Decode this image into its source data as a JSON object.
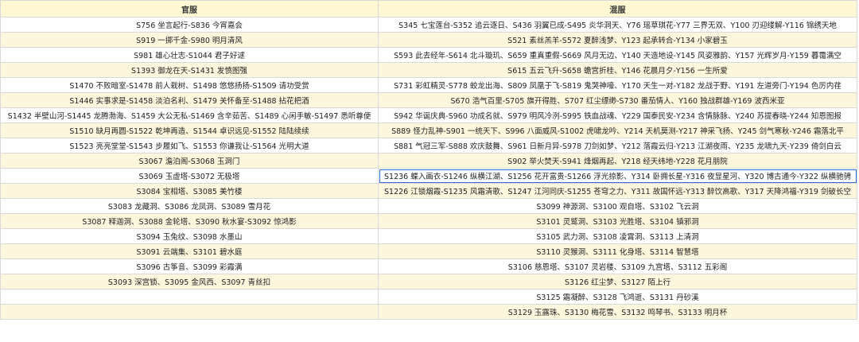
{
  "headers": [
    "官服",
    "混服"
  ],
  "rows": [
    [
      "S756 坐言起行-S836 今宵嘉会",
      "S345 七宝莲台-S352 追云逐日、S436 羽翼已成-S495 炎华洞天、Y76 瑶草琪花-Y77 三界无双、Y100 刃迎缕解-Y116 锦绣天地"
    ],
    [
      "S919 一掷千金-S980 明月清风",
      "S521 素丝羔羊-S572 夏醉浅梦、Y123 起承转合-Y134 小家碧玉"
    ],
    [
      "S981 雄心壮志-S1044 君子好逑",
      "S593 此去经年-S614 北斗璇玑、S659 重真重假-S669 风月无边、Y140 天造地设-Y145 风姿雅韵、Y157 光辉岁月-Y159 暮霭满空"
    ],
    [
      "S1393 御龙在天-S1431 发愤图强",
      "S615 五云飞升-S658 蟾宫折桂、Y146 花晨月夕-Y156 一生所爱"
    ],
    [
      "S1470 不败暗室-S1478 前人栽树、S1498 悠悠扬扬-S1509 请功受赏",
      "S731 彩虹精灵-S778 蛟龙出海、S809 凤凰于飞-S819 鬼哭神嚎、Y170 天生一对-Y182 龙战于野、Y191 左道旁门-Y194 色厉内荏"
    ],
    [
      "S1446 实事求是-S1458 淡泊名利、S1479 关怀备至-S1488 拈花把酒",
      "S670 浩气百里-S705 旗开得胜、S707 红尘缥缈-S730 番茄情人、Y160 独战群雄-Y169 波西米亚"
    ],
    [
      "S1432 半壁山河-S1445 龙腾渤海、S1459 大公无私-S1469 含辛茹苦、S1489 心闲手敏-S1497 悉听尊便",
      "S942 华诞庆典-S960 功成名就、S979 明风冷洌-S995 铁血战魂、Y229 国泰民安-Y234 含情脉脉、Y240 苏提春晓-Y244 知恩图报"
    ],
    [
      "S1510 缺月再圆-S1522 乾坤再造、S1544 卓识远见-S1552 陆陆续续",
      "S889 怪力乱神-S901 一统天下、S996 八面威风-S1002 虎啸龙吟、Y214 天机莫测-Y217 神采飞扬、Y245 剑气寒秋-Y246 霜落北平"
    ],
    [
      "S1523 亮亮堂堂-S1543 步履如飞、S1553 你谦我让-S1564 光明大道",
      "S881 气冠三军-S888 欢庆鼓舞、S961 日新月异-S978 刀剑如梦、Y212 落霞云归-Y213 江湖夜雨、Y235 龙啸九天-Y239 倚剑白云"
    ],
    [
      "S3067 澹泊阁-S3068 玉洞门",
      "S902 举火焚天-S941 烽烟再起、Y218 经天纬地-Y228 花月朋院"
    ],
    [
      "S3069 玉虚塔-S3072 无极塔",
      "S1236 蝶入画衣-S1246 纵横江湖、S1256 花开富贵-S1266 浮光掠影、Y314 卧拥长星-Y316 夜显星河、Y320 博古通今-Y322 纵横驰骋"
    ],
    [
      "S3084 宝相塔、S3085 美竹楼",
      "S1226 江锁烟霞-S1235 风霜清歌、S1247 江河同庆-S1255 苍穹之力、Y311 故国怀远-Y313 醉饮高歌、Y317 天降鸿福-Y319 剑破长空"
    ],
    [
      "S3083 龙藏洞、S3086 龙凤洞、S3089 雪月花",
      "S3099 神源洞、S3100 观自塔、S3102 飞云洞"
    ],
    [
      "S3087 释迦洞、S3088 金轮塔、S3090 秋水宴-S3092 惊鸿影",
      "S3101 灵鹫洞、S3103 光胜塔、S3104 镇邪洞"
    ],
    [
      "S3094 玉兔纹、S3098 水墨山",
      "S3105 武力洞、S3108 凌霄洞、S3113 上清洞"
    ],
    [
      "S3091 云端集、S3101 碧水庭",
      "S3110 灵猴洞、S3111 化身塔、S3114 智慧塔"
    ],
    [
      "S3096 古筝音、S3099 彩霞满",
      "S3106 慈恩塔、S3107 灵岩楼、S3109 九宫塔、S3112 五彩阁"
    ],
    [
      "S3093 深宫锁、S3095 金风西、S3097 青丝扣",
      "S3126 红尘梦、S3127 陌上行"
    ],
    [
      "",
      "S3125 霜凝醉、S3128 飞鸿逝、S3131 丹砂溪"
    ],
    [
      "",
      "S3129 玉露珠、S3130 梅花雪、S3132 鸣琴书、S3133 明月杯"
    ]
  ]
}
